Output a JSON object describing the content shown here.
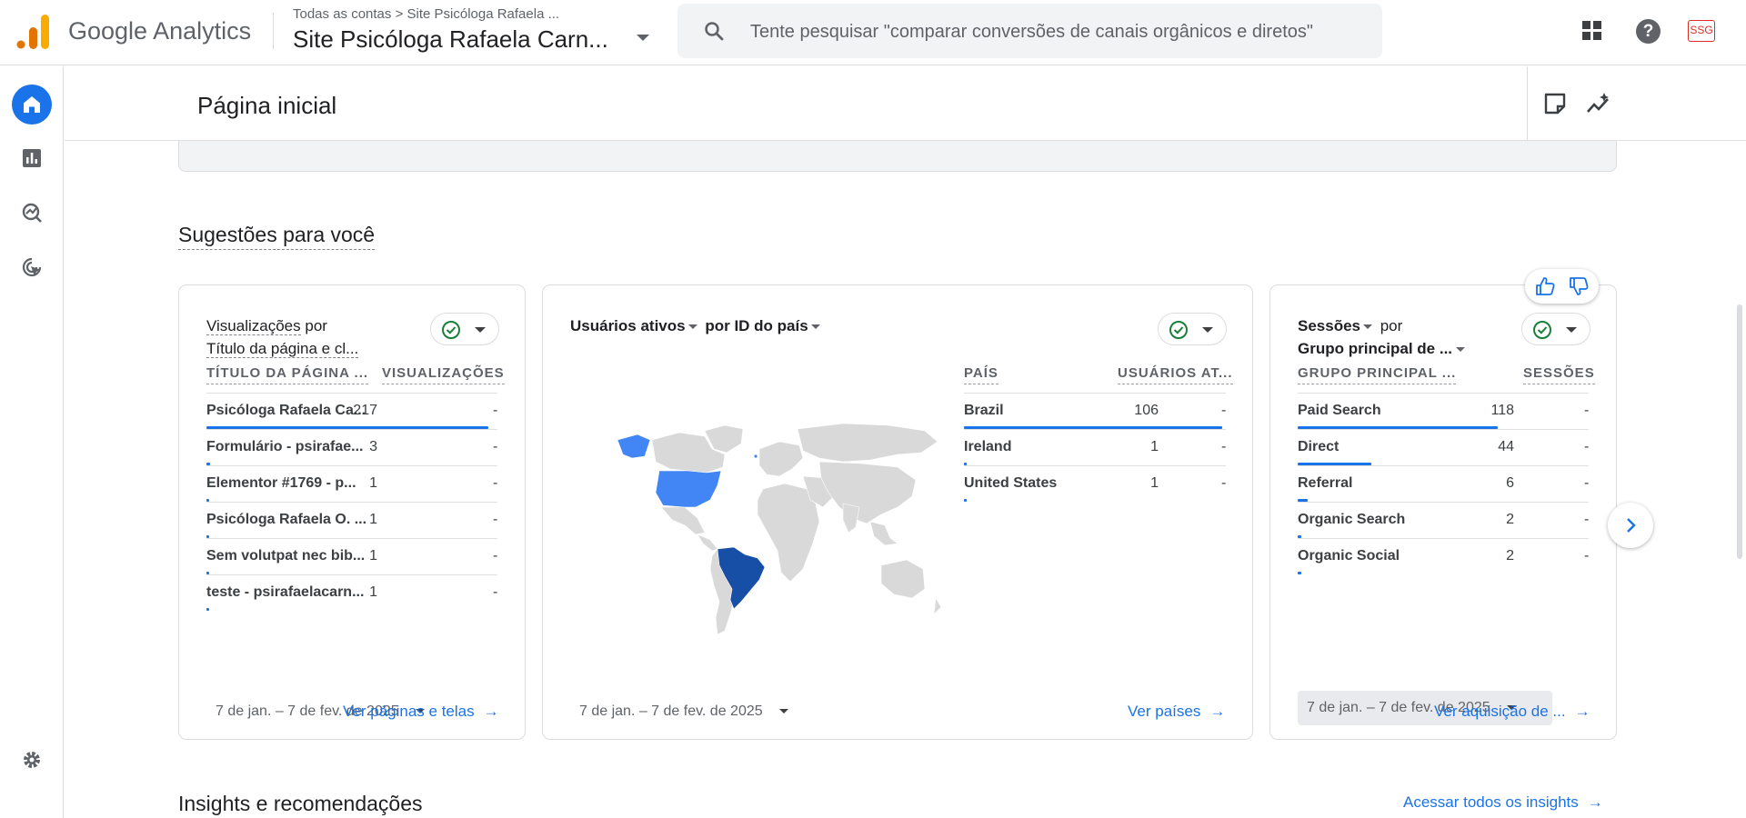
{
  "header": {
    "brand": "Google Analytics",
    "breadcrumb": "Todas as contas > Site Psicóloga Rafaela ...",
    "property": "Site Psicóloga Rafaela Carn...",
    "search_placeholder": "Tente pesquisar \"comparar conversões de canais orgânicos e diretos\"",
    "avatar": "SSG",
    "help": "?"
  },
  "page": {
    "title": "Página inicial",
    "suggestions_title": "Sugestões para você",
    "insights_title": "Insights e recomendações",
    "insights_link": "Acessar todos os insights"
  },
  "cards": [
    {
      "title_part1": "Visualizações",
      "title_part2": " por",
      "title_line2": "Título da página e cl...",
      "col1": "TÍTULO DA PÁGINA ...",
      "col2": "VISUALIZAÇÕES",
      "rows": [
        {
          "label": "Psicóloga Rafaela Ca...",
          "value": "217",
          "dash": "-",
          "fraction": 1.0
        },
        {
          "label": "Formulário - psirafae...",
          "value": "3",
          "dash": "-",
          "fraction": 0.014
        },
        {
          "label": "Elementor #1769 - p...",
          "value": "1",
          "dash": "-",
          "fraction": 0.005
        },
        {
          "label": "Psicóloga Rafaela O. ...",
          "value": "1",
          "dash": "-",
          "fraction": 0.005
        },
        {
          "label": "Sem volutpat nec bib...",
          "value": "1",
          "dash": "-",
          "fraction": 0.005
        },
        {
          "label": "teste - psirafaelacarn...",
          "value": "1",
          "dash": "-",
          "fraction": 0.005
        }
      ],
      "date": "7 de jan. – 7 de fev. de 2025",
      "link": "Ver páginas e telas"
    },
    {
      "title_part1": "Usuários ativos",
      "title_part2": " por ID do país",
      "col1": "PAÍS",
      "col2": "USUÁRIOS AT...",
      "rows": [
        {
          "label": "Brazil",
          "value": "106",
          "dash": "-",
          "fraction": 1.0
        },
        {
          "label": "Ireland",
          "value": "1",
          "dash": "-",
          "fraction": 0.01
        },
        {
          "label": "United States",
          "value": "1",
          "dash": "-",
          "fraction": 0.01
        }
      ],
      "date": "7 de jan. – 7 de fev. de 2025",
      "link": "Ver países",
      "map_colors": {
        "brazil": "#174ea6",
        "usa": "#4285f4",
        "land": "#d9d9d9"
      }
    },
    {
      "title_part1": "Sessões",
      "title_part2": " por",
      "title_line2": "Grupo principal de ...",
      "col1": "GRUPO PRINCIPAL ...",
      "col2": "SESSÕES",
      "rows": [
        {
          "label": "Paid Search",
          "value": "118",
          "dash": "-",
          "fraction": 1.0
        },
        {
          "label": "Direct",
          "value": "44",
          "dash": "-",
          "fraction": 0.37
        },
        {
          "label": "Referral",
          "value": "6",
          "dash": "-",
          "fraction": 0.05
        },
        {
          "label": "Organic Search",
          "value": "2",
          "dash": "-",
          "fraction": 0.017
        },
        {
          "label": "Organic Social",
          "value": "2",
          "dash": "-",
          "fraction": 0.017
        }
      ],
      "date": "7 de jan. – 7 de fev. de 2025",
      "link": "Ver aquisição de ..."
    }
  ],
  "colors": {
    "accent": "#1a73e8",
    "check": "#188038"
  }
}
